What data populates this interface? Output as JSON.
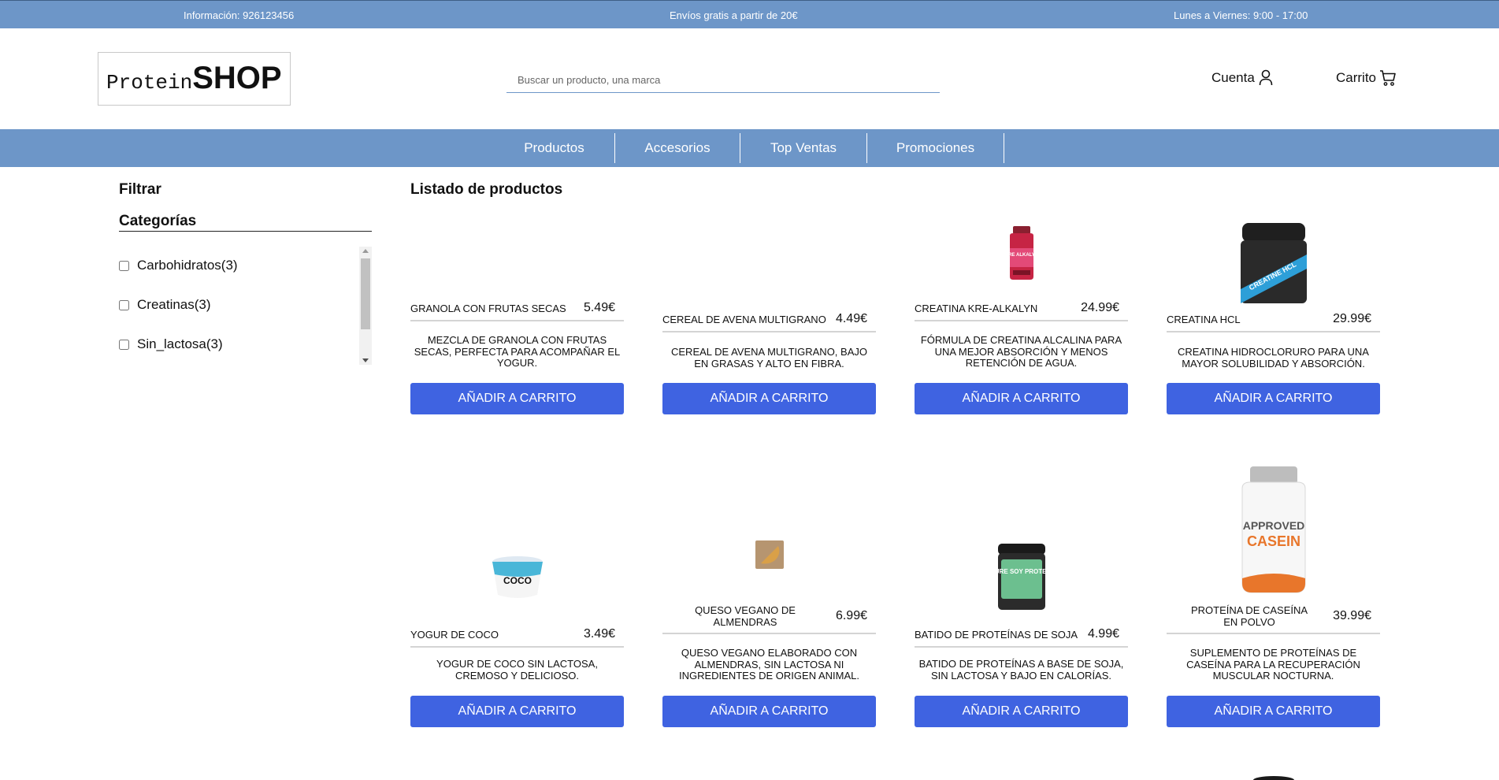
{
  "topbar": {
    "info": "Información: 926123456",
    "shipping": "Envíos gratis a partir de 20€",
    "hours": "Lunes a Viernes: 9:00 - 17:00"
  },
  "header": {
    "logo_part1": "Protein",
    "logo_part2": "SHOP",
    "search_placeholder": "Buscar un producto, una marca",
    "account_label": "Cuenta",
    "cart_label": "Carrito"
  },
  "nav": {
    "items": [
      {
        "label": "Productos"
      },
      {
        "label": "Accesorios"
      },
      {
        "label": "Top Ventas"
      },
      {
        "label": "Promociones"
      }
    ]
  },
  "sidebar": {
    "title": "Filtrar",
    "categories_title": "Categorías",
    "categories": [
      {
        "name": "Carbohidratos",
        "count": "(3)"
      },
      {
        "name": "Creatinas",
        "count": "(3)"
      },
      {
        "name": "Sin_lactosa",
        "count": "(3)"
      }
    ]
  },
  "products": {
    "title": "Listado de productos",
    "button_label": "AÑADIR A CARRITO",
    "items": [
      {
        "name": "Granola con frutas secas",
        "price": "5.49€",
        "description": "Mezcla de granola con frutas secas, perfecta para acompañar el yogur.",
        "image": "none"
      },
      {
        "name": "Cereal de avena multigrano",
        "price": "4.49€",
        "description": "Cereal de avena multigrano, bajo en grasas y alto en fibra.",
        "image": "none"
      },
      {
        "name": "Creatina Kre-Alkalyn",
        "price": "24.99€",
        "description": "Fórmula de creatina alcalina para una mejor absorción y menos retención de agua.",
        "image": "creatine-bottle",
        "img_text": "KRE ALKALYN"
      },
      {
        "name": "Creatina HCL",
        "price": "29.99€",
        "description": "Creatina hidrocloruro para una mayor solubilidad y absorción.",
        "image": "creatine-tub",
        "img_text": "CREATINE HCL"
      },
      {
        "name": "Yogur de coco",
        "price": "3.49€",
        "description": "Yogur de coco sin lactosa, cremoso y delicioso.",
        "image": "yogurt-cup",
        "img_text": "COCO"
      },
      {
        "name": "Queso vegano de almendras",
        "price": "6.99€",
        "description": "Queso vegano elaborado con almendras, sin lactosa ni ingredientes de origen animal.",
        "image": "cheese-package"
      },
      {
        "name": "Batido de proteínas de soja",
        "price": "4.99€",
        "description": "Batido de proteínas a base de soja, sin lactosa y bajo en calorías.",
        "image": "soy-tub",
        "img_text": "PURE SOY PROTEIN"
      },
      {
        "name": "Proteína de caseína en polvo",
        "price": "39.99€",
        "description": "Suplemento de proteínas de caseína para la recuperación muscular nocturna.",
        "image": "casein-tub",
        "img_text_1": "APPROVED",
        "img_text_2": "CASEIN"
      }
    ]
  }
}
